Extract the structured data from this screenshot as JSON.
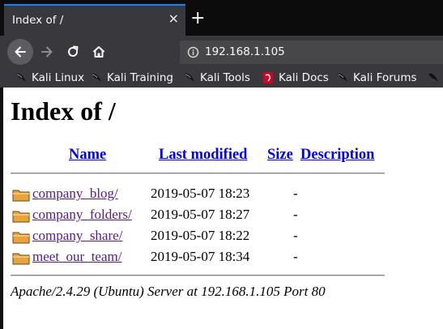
{
  "browser": {
    "tab": {
      "title": "Index of /",
      "close": "×"
    },
    "new_tab": "+",
    "url": "192.168.1.105",
    "bookmarks": [
      {
        "label": "Kali Linux",
        "icon": "kali-dragon-icon"
      },
      {
        "label": "Kali Training",
        "icon": "kali-dragon-icon"
      },
      {
        "label": "Kali Tools",
        "icon": "kali-dragon-icon"
      },
      {
        "label": "Kali Docs",
        "icon": "kali-docs-icon"
      },
      {
        "label": "Kali Forums",
        "icon": "kali-dragon-icon"
      }
    ]
  },
  "page": {
    "title": "Index of /",
    "columns": {
      "name": "Name",
      "last_modified": "Last modified",
      "size": "Size",
      "description": "Description"
    },
    "rows": [
      {
        "name": "company_blog/",
        "modified": "2019-05-07 18:23",
        "size": "-"
      },
      {
        "name": "company_folders/",
        "modified": "2019-05-07 18:27",
        "size": "-"
      },
      {
        "name": "company_share/",
        "modified": "2019-05-07 18:22",
        "size": "-"
      },
      {
        "name": "meet_our_team/",
        "modified": "2019-05-07 18:34",
        "size": "-"
      }
    ],
    "footer": "Apache/2.4.29 (Ubuntu) Server at 192.168.1.105 Port 80"
  },
  "colors": {
    "tab_accent": "#0a84ff",
    "chrome_dark": "#0c0c0d",
    "chrome": "#38383d",
    "link": "#0000ee",
    "visited_link": "#551a8b"
  }
}
